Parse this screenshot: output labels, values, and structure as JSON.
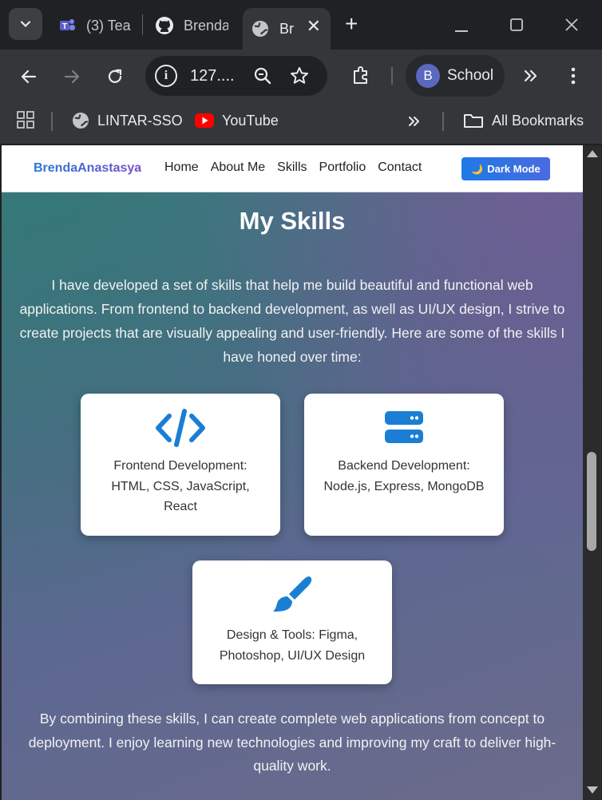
{
  "browser": {
    "tabs": [
      {
        "title": "(3) Tea",
        "icon": "teams-icon"
      },
      {
        "title": "Brenda",
        "icon": "github-icon"
      },
      {
        "title": "Br",
        "icon": "globe-icon"
      }
    ],
    "url": "127....",
    "profile": {
      "initial": "B",
      "name": "School"
    },
    "bookmarks": [
      {
        "label": "LINTAR-SSO",
        "icon": "globe-icon"
      },
      {
        "label": "YouTube",
        "icon": "youtube-icon"
      },
      {
        "label": "All Bookmarks",
        "icon": "folder-icon"
      }
    ]
  },
  "site": {
    "brand": "BrendaAnastasya",
    "nav": [
      "Home",
      "About Me",
      "Skills",
      "Portfolio",
      "Contact"
    ],
    "dark_mode": "Dark Mode"
  },
  "skills": {
    "title": "My Skills",
    "intro": "I have developed a set of skills that help me build beautiful and functional web applications. From frontend to backend development, as well as UI/UX design, I strive to create projects that are visually appealing and user-friendly. Here are some of the skills I have honed over time:",
    "cards": [
      {
        "icon": "code-icon",
        "text": "Frontend Development: HTML, CSS, JavaScript, React"
      },
      {
        "icon": "server-icon",
        "text": "Backend Development: Node.js, Express, MongoDB"
      },
      {
        "icon": "paint-brush-icon",
        "text": "Design & Tools: Figma, Photoshop, UI/UX Design"
      }
    ],
    "outro": "By combining these skills, I can create complete web applications from concept to deployment. I enjoy learning new technologies and improving my craft to deliver high-quality work."
  },
  "colors": {
    "accent": "#1e7ae6",
    "icon_blue": "#1a7fd4",
    "chrome_dark": "#202124",
    "chrome_toolbar": "#35363a"
  }
}
